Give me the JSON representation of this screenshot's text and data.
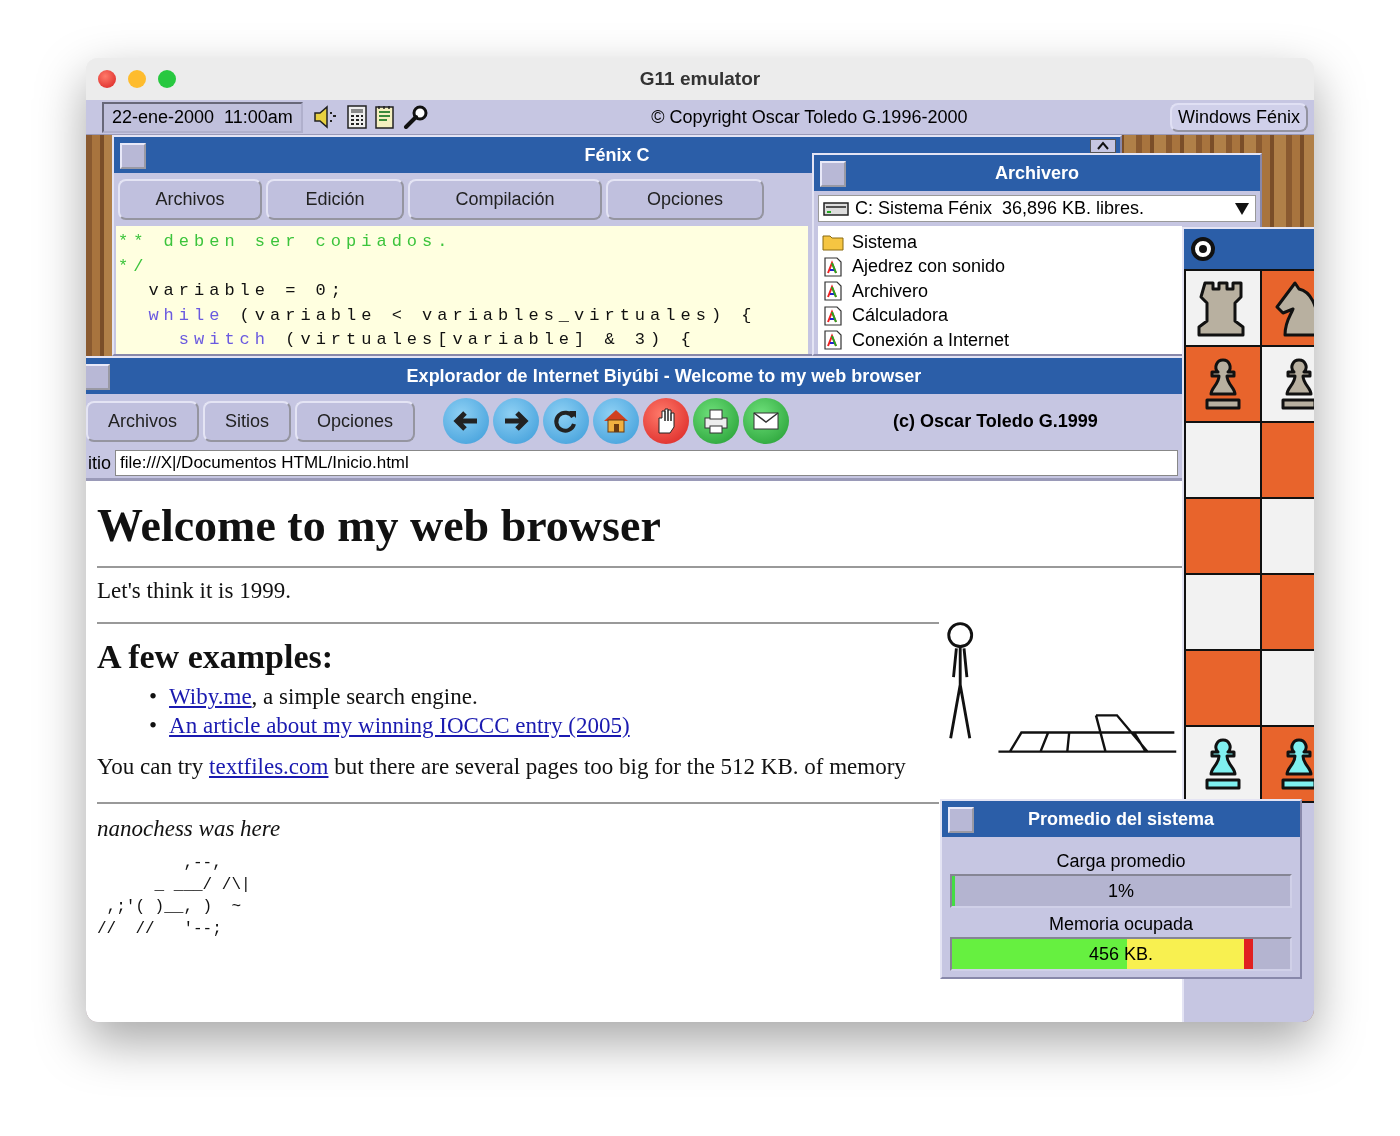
{
  "window": {
    "title": "G11 emulator"
  },
  "top_bar": {
    "datetime": "22-ene-2000  11:00am",
    "copyright": "© Copyright Oscar Toledo G.1996-2000",
    "button": "Windows Fénix"
  },
  "code_editor": {
    "title": "Fénix C",
    "menu": [
      "Archivos",
      "Edición",
      "Compilación",
      "Opciones"
    ],
    "lines": [
      [
        {
          "text": "** deben ser copiados.",
          "kind": "comment"
        }
      ],
      [
        {
          "text": "*/",
          "kind": "comment"
        }
      ],
      [
        {
          "text": "  variable = 0;",
          "kind": "plain"
        }
      ],
      [
        {
          "text": "  while",
          "kind": "keyword"
        },
        {
          "text": " (variable < variables_virtuales) {",
          "kind": "plain"
        }
      ],
      [
        {
          "text": "    switch",
          "kind": "keyword"
        },
        {
          "text": " (virtuales[variable] & 3) {",
          "kind": "plain"
        }
      ]
    ]
  },
  "file_manager": {
    "title": "Archivero",
    "drive": "C: Sistema Fénix  36,896 KB. libres.",
    "items": [
      {
        "name": "Sistema",
        "kind": "folder"
      },
      {
        "name": "Ajedrez con sonido",
        "kind": "app"
      },
      {
        "name": "Archivero",
        "kind": "app"
      },
      {
        "name": "Cálculadora",
        "kind": "app"
      },
      {
        "name": "Conexión a Internet",
        "kind": "app"
      }
    ]
  },
  "browser": {
    "title": "Explorador de Internet Biyúbi - Welcome to my web browser",
    "menu": [
      "Archivos",
      "Sitios",
      "Opciones"
    ],
    "credit": "(c) Oscar Toledo G.1999",
    "address_label": "itio",
    "address": "file:///X|/Documentos HTML/Inicio.html",
    "page": {
      "heading": "Welcome to my web browser",
      "intro": "Let's think it is 1999.",
      "subheading": "A few examples:",
      "list": [
        {
          "bullet": "•",
          "segments": [
            {
              "text": "Wiby.me",
              "link": true
            },
            {
              "text": ", a simple search engine.",
              "link": false
            }
          ]
        },
        {
          "bullet": "•",
          "segments": [
            {
              "text": "An article about my winning IOCCC entry (2005)",
              "link": true
            }
          ]
        }
      ],
      "paragraph": [
        {
          "text": "You can try ",
          "link": false
        },
        {
          "text": "textfiles.com",
          "link": true
        },
        {
          "text": " but there are several pages too big for the 512 KB. of memory",
          "link": false
        }
      ],
      "signature": "nanochess was here",
      "ascii_art": "         ,--,\n      _ ___/ /\\|\n ,;'( )__, )  ~\n//  //   '--;"
    }
  },
  "system_monitor": {
    "title": "Promedio del sistema",
    "meters": [
      {
        "label": "Carga promedio",
        "level": 0.01,
        "reading": "1%"
      },
      {
        "label": "Memoria ocupada",
        "level": 0.89,
        "reading": "456 KB."
      }
    ]
  }
}
